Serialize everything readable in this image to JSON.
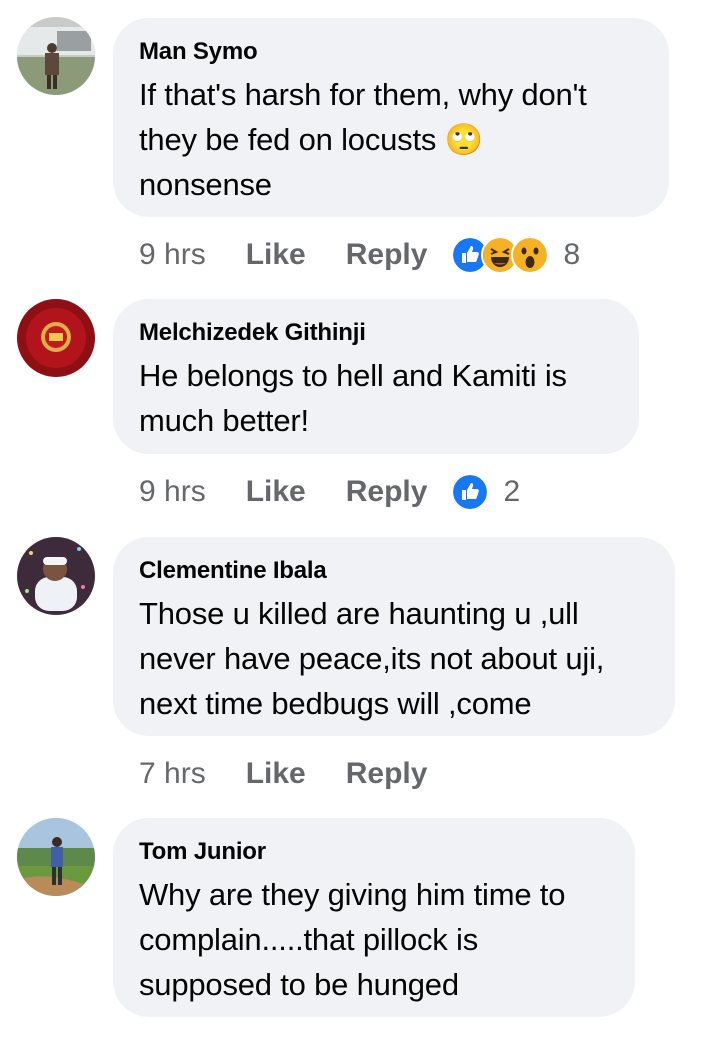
{
  "comments": [
    {
      "author": "Man Symo",
      "text_lines": [
        "If that's harsh for them, why don't",
        "they be fed on locusts 🙄",
        "nonsense"
      ],
      "time": "9 hrs",
      "like_label": "Like",
      "reply_label": "Reply",
      "reactions": [
        "like-icon",
        "laugh-icon",
        "wow-icon"
      ],
      "reaction_count": "8"
    },
    {
      "author": "Melchizedek Githinji",
      "text_lines": [
        "He belongs to hell and Kamiti is",
        "much better!"
      ],
      "time": "9 hrs",
      "like_label": "Like",
      "reply_label": "Reply",
      "reactions": [
        "like-icon"
      ],
      "reaction_count": "2"
    },
    {
      "author": "Clementine Ibala",
      "text_lines": [
        "Those u killed are haunting u ,ull",
        "never have peace,its not about uji,",
        "next time bedbugs will ,come"
      ],
      "time": "7 hrs",
      "like_label": "Like",
      "reply_label": "Reply"
    },
    {
      "author": "Tom Junior",
      "text_lines": [
        "Why are they giving him time to",
        "complain.....that pillock is",
        "supposed to be hunged"
      ]
    }
  ],
  "colors": {
    "bubble": "#f0f2f5",
    "meta_text": "#65676b",
    "like_blue": "#1877f2",
    "reaction_yellow": "#f7b125"
  }
}
